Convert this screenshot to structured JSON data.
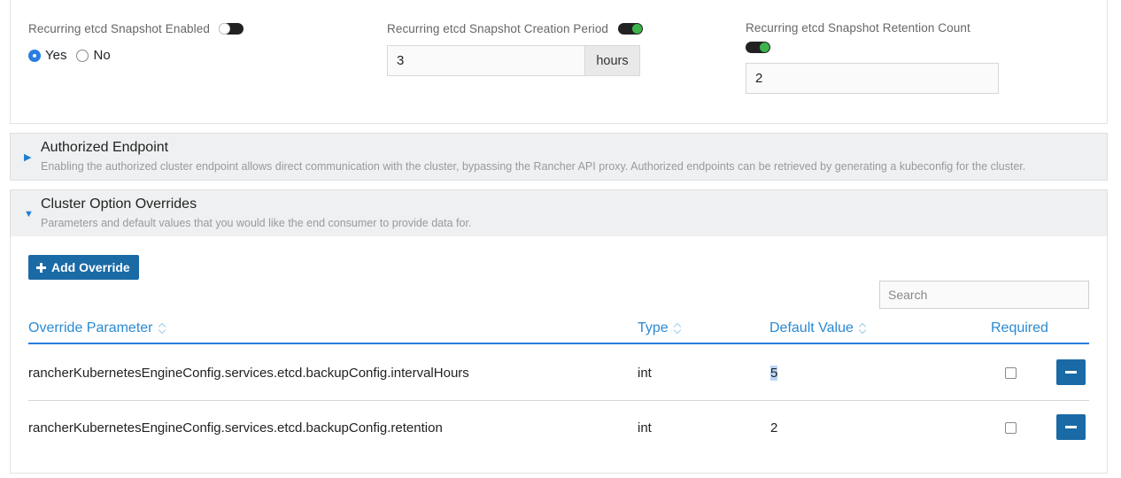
{
  "etcd": {
    "enabled": {
      "label": "Recurring etcd Snapshot Enabled",
      "toggle_state": "off",
      "options": [
        "Yes",
        "No"
      ],
      "selected": "Yes"
    },
    "period": {
      "label": "Recurring etcd Snapshot Creation Period",
      "toggle_state": "on",
      "value": "3",
      "unit": "hours"
    },
    "retention": {
      "label": "Recurring etcd Snapshot Retention Count",
      "toggle_state": "on",
      "value": "2"
    }
  },
  "authorized_endpoint": {
    "title": "Authorized Endpoint",
    "description": "Enabling the authorized cluster endpoint allows direct communication with the cluster, bypassing the Rancher API proxy. Authorized endpoints can be retrieved by generating a kubeconfig for the cluster.",
    "expanded": false,
    "arrow": "▶"
  },
  "overrides": {
    "title": "Cluster Option Overrides",
    "description": "Parameters and default values that you would like the end consumer to provide data for.",
    "expanded": true,
    "arrow": "▼",
    "add_button_label": "Add Override",
    "search_placeholder": "Search",
    "columns": {
      "parameter": "Override Parameter",
      "type": "Type",
      "default": "Default Value",
      "required": "Required"
    },
    "rows": [
      {
        "parameter": "rancherKubernetesEngineConfig.services.etcd.backupConfig.intervalHours",
        "type": "int",
        "default": "5",
        "required": false
      },
      {
        "parameter": "rancherKubernetesEngineConfig.services.etcd.backupConfig.retention",
        "type": "int",
        "default": "2",
        "required": false
      }
    ]
  },
  "colors": {
    "primary_button": "#1a6aa6",
    "link_blue": "#2a8ad3",
    "toggle_on": "#3cb44b"
  }
}
